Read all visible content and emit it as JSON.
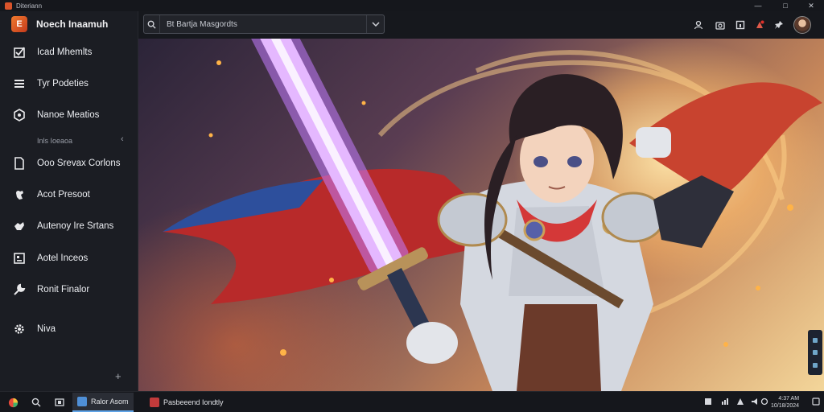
{
  "window": {
    "title": "Diteriann"
  },
  "brand": {
    "name": "Noech Inaamuh",
    "logo_letter": "E"
  },
  "sidebar": {
    "items": [
      {
        "label": "Icad Mhemlts",
        "icon": "checkbox-icon"
      },
      {
        "label": "Tyr Podeties",
        "icon": "list-icon"
      },
      {
        "label": "Nanoe Meatios",
        "icon": "hexagon-icon"
      }
    ],
    "section_label": "Inls Ioeaoa",
    "section_items": [
      {
        "label": "Ooo Srevax Corlons",
        "icon": "document-icon"
      },
      {
        "label": "Acot Presoot",
        "icon": "fist-icon"
      },
      {
        "label": "Autenoy Ire Srtans",
        "icon": "hand-icon"
      },
      {
        "label": "Aotel Inceos",
        "icon": "image-frame-icon"
      },
      {
        "label": "Ronit Finalor",
        "icon": "wrench-icon"
      },
      {
        "label": "Niva",
        "icon": "gear-icon"
      }
    ]
  },
  "search": {
    "value": "Bt Bartja Masgordts"
  },
  "taskbar": {
    "apps": [
      {
        "label": "Ralor Asom",
        "color": "#4f8fd6"
      },
      {
        "label": "Pasbeeend Iondtly",
        "color": "#c23b3b"
      }
    ],
    "clock_line1": "4:37 AM",
    "clock_line2": "10/18/2024"
  },
  "colors": {
    "accent": "#5fa3e6",
    "brand": "#e0632a",
    "sidebar_bg": "#1b1d23"
  }
}
